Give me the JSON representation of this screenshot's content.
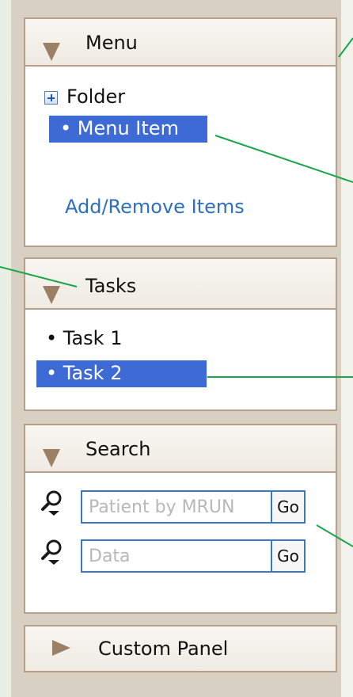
{
  "menu_panel": {
    "title": "Menu",
    "folder_label": "Folder",
    "selected_item": "• Menu Item",
    "add_remove_link": "Add/Remove Items"
  },
  "tasks_panel": {
    "title": "Tasks",
    "items": [
      {
        "label": "• Task 1",
        "selected": false
      },
      {
        "label": "• Task 2",
        "selected": true
      }
    ]
  },
  "search_panel": {
    "title": "Search",
    "fields": [
      {
        "placeholder": "Patient by MRUN",
        "value": "",
        "button": "Go"
      },
      {
        "placeholder": "Data",
        "value": "",
        "button": "Go"
      }
    ]
  },
  "custom_panel": {
    "title": "Custom Panel",
    "expanded": false
  },
  "icons": {
    "expand_collapse": "triangle-down-icon",
    "collapsed": "triangle-right-icon",
    "search": "person-search-icon",
    "folder_expand": "plus-box-icon"
  },
  "colors": {
    "sidebar_bg": "#d8d0c3",
    "panel_border": "#b79f89",
    "header_triangle": "#9b8066",
    "selection": "#3d6ad4",
    "link": "#2f6fc0",
    "callout_line": "#1aa64a",
    "input_border": "#3c78c0"
  }
}
